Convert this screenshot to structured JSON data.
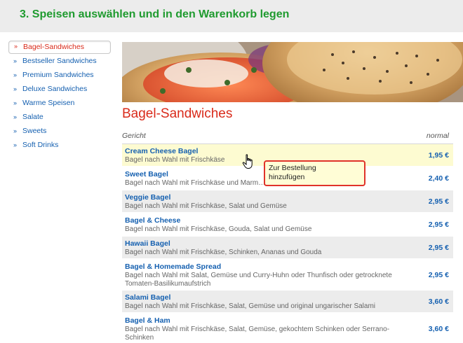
{
  "header": {
    "title": "3. Speisen auswählen und in den Warenkorb legen"
  },
  "sidebar": {
    "items": [
      {
        "label": "Bagel-Sandwiches",
        "active": true
      },
      {
        "label": "Bestseller Sandwiches"
      },
      {
        "label": "Premium Sandwiches"
      },
      {
        "label": "Deluxe Sandwiches"
      },
      {
        "label": "Warme Speisen"
      },
      {
        "label": "Salate"
      },
      {
        "label": "Sweets"
      },
      {
        "label": "Soft Drinks"
      }
    ],
    "arrow": "»"
  },
  "main": {
    "section_title": "Bagel-Sandwiches",
    "table": {
      "col_dish": "Gericht",
      "col_price": "normal",
      "rows": [
        {
          "name": "Cream Cheese Bagel",
          "desc": "Bagel nach Wahl mit Frischkäse",
          "price": "1,95 €"
        },
        {
          "name": "Sweet Bagel",
          "desc": "Bagel nach Wahl mit Frischkäse und Marm…adencreme",
          "price": "2,40 €"
        },
        {
          "name": "Veggie Bagel",
          "desc": "Bagel nach Wahl mit Frischkäse, Salat und Gemüse",
          "price": "2,95 €"
        },
        {
          "name": "Bagel & Cheese",
          "desc": "Bagel nach Wahl mit Frischkäse, Gouda, Salat und Gemüse",
          "price": "2,95 €"
        },
        {
          "name": "Hawaii Bagel",
          "desc": "Bagel nach Wahl mit Frischkäse, Schinken, Ananas und Gouda",
          "price": "2,95 €"
        },
        {
          "name": "Bagel & Homemade Spread",
          "desc": "Bagel nach Wahl mit Salat, Gemüse und Curry-Huhn oder Thunfisch oder getrocknete Tomaten-Basilikumaufstrich",
          "price": "2,95 €"
        },
        {
          "name": "Salami Bagel",
          "desc": "Bagel nach Wahl mit Frischkäse, Salat, Gemüse und original ungarischer Salami",
          "price": "3,60 €"
        },
        {
          "name": "Bagel & Ham",
          "desc": "Bagel nach Wahl mit Frischkäse, Salat, Gemüse, gekochtem Schinken oder Serrano-Schinken",
          "price": "3,60 €"
        }
      ]
    },
    "tooltip": {
      "line1": "Zur Bestellung",
      "line2": "hinzufügen"
    }
  },
  "colors": {
    "accent_red": "#d92a1a",
    "link_blue": "#1560b0",
    "header_green": "#1f9b2f",
    "row_grey": "#ececec",
    "row_hover": "#fdfbd1"
  }
}
